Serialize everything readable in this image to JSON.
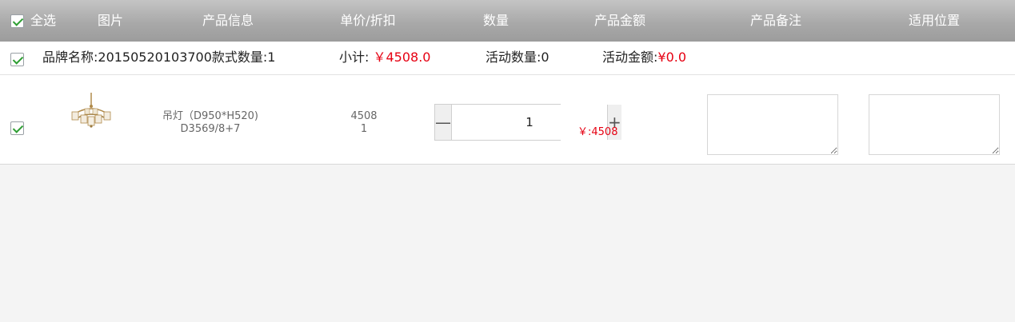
{
  "header": {
    "select_all": "全选",
    "image": "图片",
    "product_info": "产品信息",
    "unit_price": "单价/折扣",
    "quantity": "数量",
    "amount": "产品金额",
    "remark": "产品备注",
    "position": "适用位置"
  },
  "brand_row": {
    "brand_label": "品牌名称:20150520103700款式数量:1",
    "subtotal_label": "小计:",
    "subtotal_value": "￥4508.0",
    "activity_qty": "活动数量:0",
    "activity_amount_label": "活动金额:",
    "activity_amount_value": "¥0.0"
  },
  "item": {
    "name": "吊灯（D950*H520)",
    "model": "D3569/8+7",
    "price": "4508",
    "discount": "1",
    "quantity": "1",
    "minus": "—",
    "plus": "+",
    "amount": "￥:4508",
    "checked": true
  },
  "colors": {
    "header_bg": "#a9a9a9",
    "accent_red": "#e60012",
    "check_green": "#2e9e33"
  },
  "icons": {
    "checkbox": "check-icon",
    "product_thumbnail": "chandelier-image"
  }
}
